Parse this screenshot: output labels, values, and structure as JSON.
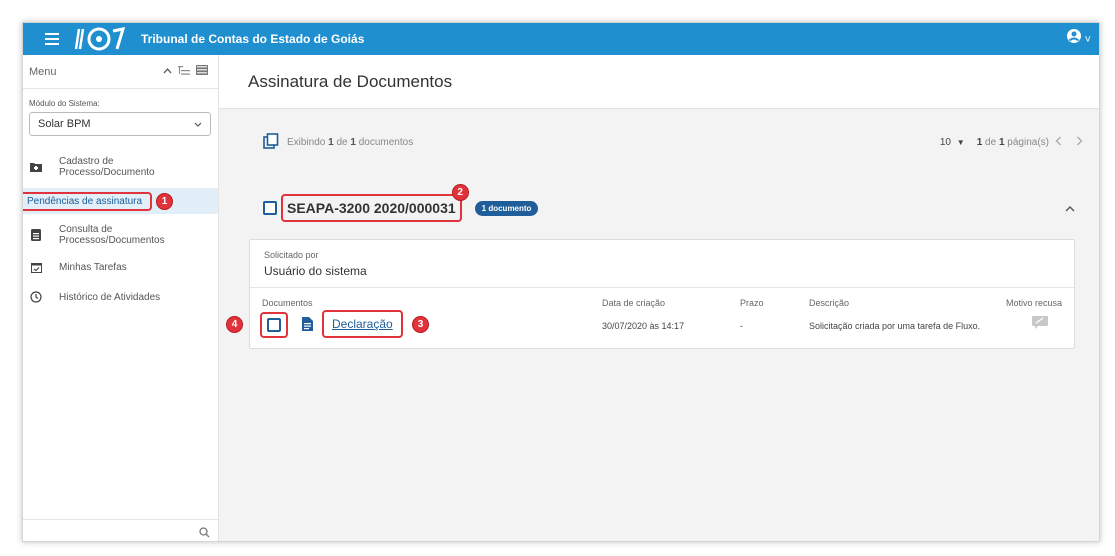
{
  "header": {
    "app_title": "Tribunal de Contas do Estado de Goiás",
    "user_menu_chevron": "˅"
  },
  "sidebar": {
    "menu_title": "Menu",
    "module_label": "Módulo do Sistema:",
    "module_value": "Solar BPM",
    "items": [
      {
        "label": "Cadastro de Processo/Documento",
        "line1": "Cadastro de",
        "line2": "Processo/Documento",
        "icon": "folder-icon"
      },
      {
        "label": "Pendências de assinatura",
        "icon": "none",
        "badge": "1"
      },
      {
        "label": "Consulta de Processos/Documentos",
        "line1": "Consulta de",
        "line2": "Processos/Documentos",
        "icon": "document-icon"
      },
      {
        "label": "Minhas Tarefas",
        "icon": "calendar-check-icon"
      },
      {
        "label": "Histórico de Atividades",
        "icon": "clock-icon"
      }
    ]
  },
  "main": {
    "page_title": "Assinatura de Documentos",
    "toolbar": {
      "exibindo": "Exibindo",
      "count": "1",
      "de": "de",
      "total": "1",
      "suffix": "documentos"
    },
    "pager": {
      "page_size": "10",
      "page_current": "1",
      "de": "de",
      "page_total": "1",
      "suffix": "página(s)"
    },
    "group": {
      "code": "SEAPA-3200 2020/000031",
      "count_label": "1 documento",
      "badge": "2"
    },
    "card": {
      "requested_by_label": "Solicitado por",
      "requested_by": "Usuário do sistema",
      "columns": {
        "documentos": "Documentos",
        "data": "Data de criação",
        "prazo": "Prazo",
        "descricao": "Descrição",
        "motivo": "Motivo recusa"
      },
      "row": {
        "documento": "Declaração",
        "data": "30/07/2020 às 14:17",
        "prazo": "-",
        "descricao": "Solicitação criada por uma tarefa de Fluxo."
      },
      "badge_doc": "3",
      "badge_cb": "4"
    }
  },
  "colors": {
    "topbar": "#1f8fd0",
    "accent_dark": "#1f5e9a",
    "callout_red": "#e0333b"
  }
}
